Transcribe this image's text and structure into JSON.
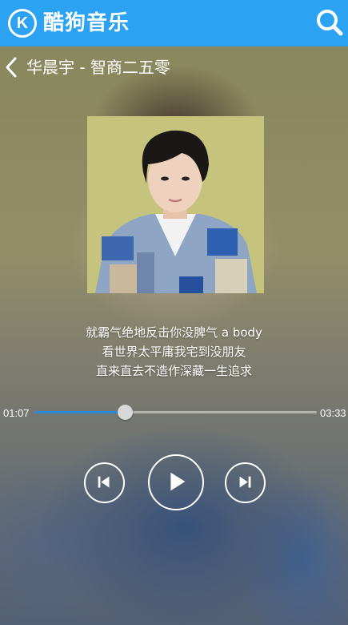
{
  "header": {
    "logo_letter": "K",
    "app_name": "酷狗音乐",
    "search_icon": "search-icon",
    "accent_color": "#2ca2f3"
  },
  "player": {
    "song_title": "华晨宇 - 智商二五零",
    "back_icon": "chevron-left-icon",
    "lyrics": [
      "就霸气绝地反击你没脾气 a body",
      "看世界太平庸我宅到没朋友",
      "直来直去不造作深藏一生追求"
    ],
    "current_time": "01:07",
    "total_time": "03:33",
    "progress": 0.32,
    "progress_color": "#2b87d8",
    "controls": {
      "prev_icon": "skip-previous-icon",
      "play_icon": "play-icon",
      "next_icon": "skip-next-icon"
    }
  }
}
